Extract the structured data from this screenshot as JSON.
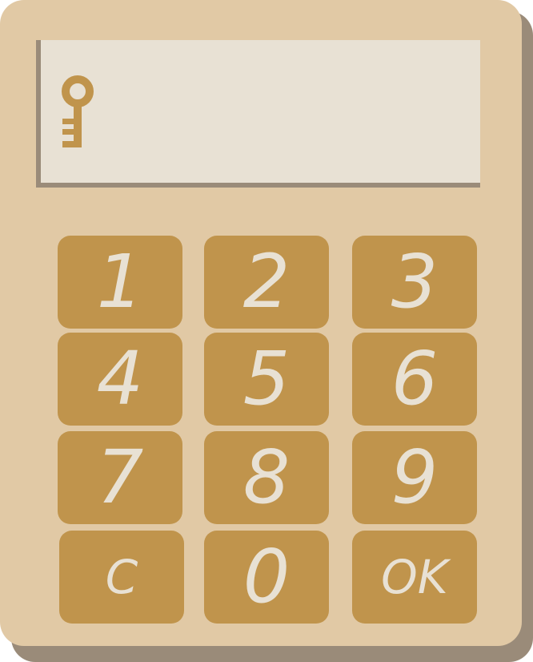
{
  "display": {
    "value": "",
    "icon": "key-icon"
  },
  "keypad": {
    "keys": [
      {
        "label": "1"
      },
      {
        "label": "2"
      },
      {
        "label": "3"
      },
      {
        "label": "4"
      },
      {
        "label": "5"
      },
      {
        "label": "6"
      },
      {
        "label": "7"
      },
      {
        "label": "8"
      },
      {
        "label": "9"
      },
      {
        "label": "C"
      },
      {
        "label": "0"
      },
      {
        "label": "OK"
      }
    ]
  },
  "colors": {
    "body": "#e1c9a5",
    "shadow": "#9a8b79",
    "screen": "#e8e1d4",
    "button": "#c0944c",
    "button_text": "#e8e1d4"
  }
}
